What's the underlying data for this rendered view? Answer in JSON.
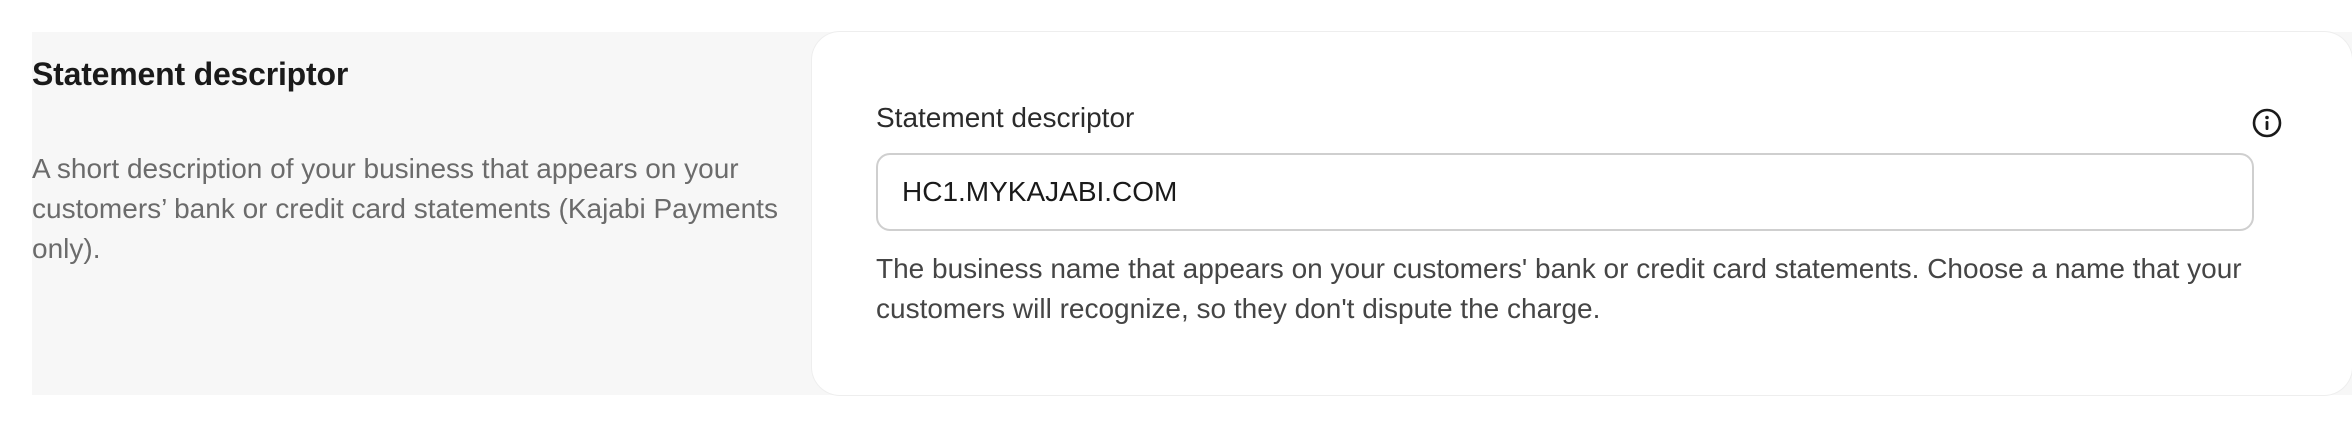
{
  "section": {
    "title": "Statement descriptor",
    "description": "A short description of your business that appears on your customers’ bank or credit card statements (Kajabi Payments only)."
  },
  "field": {
    "label": "Statement descriptor",
    "value": "HC1.MYKAJABI.COM",
    "help": "The business name that appears on your customers' bank or credit card statements. Choose a name that your customers will recognize, so they don't dispute the charge.",
    "info_icon": "info-circle-icon"
  }
}
